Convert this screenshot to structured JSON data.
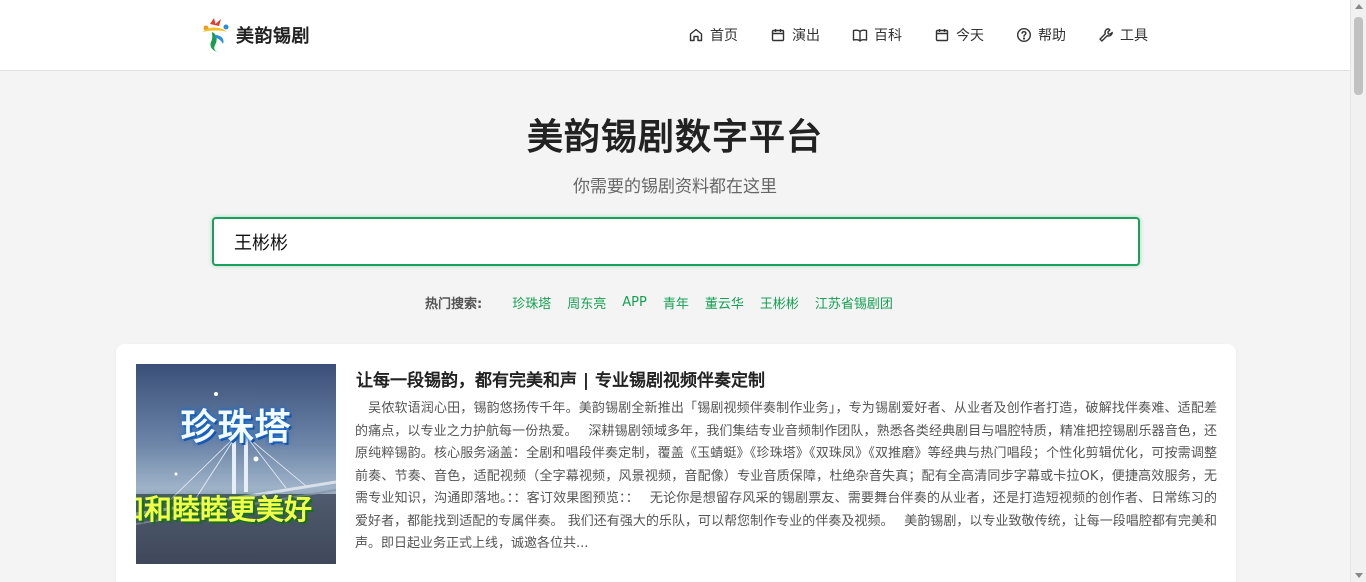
{
  "brand": {
    "name": "美韵锡剧"
  },
  "nav": [
    {
      "label": "首页",
      "icon": "home-icon"
    },
    {
      "label": "演出",
      "icon": "calendar-icon"
    },
    {
      "label": "百科",
      "icon": "book-icon"
    },
    {
      "label": "今天",
      "icon": "calendar-icon"
    },
    {
      "label": "帮助",
      "icon": "help-circle-icon"
    },
    {
      "label": "工具",
      "icon": "wrench-icon"
    }
  ],
  "hero": {
    "title": "美韵锡剧数字平台",
    "subtitle": "你需要的锡剧资料都在这里"
  },
  "search": {
    "value": "王彬彬"
  },
  "hot_search": {
    "label": "热门搜索:",
    "tags": [
      "珍珠塔",
      "周东亮",
      "APP",
      "青年",
      "董云华",
      "王彬彬",
      "江苏省锡剧团"
    ]
  },
  "result": {
    "thumb_title": "珍珠塔",
    "thumb_subtitle": "和和睦睦更美好",
    "title": "让每一段锡韵，都有完美和声 | 专业锡剧视频伴奏定制",
    "description": "　吴侬软语润心田，锡韵悠扬传千年。美韵锡剧全新推出「锡剧视频伴奏制作业务」，专为锡剧爱好者、从业者及创作者打造，破解找伴奏难、适配差的痛点，以专业之力护航每一份热爱。　  深耕锡剧领域多年，我们集结专业音频制作团队，熟悉各类经典剧目与唱腔特质，精准把控锡剧乐器音色，还原纯粹锡韵。核心服务涵盖：全剧和唱段伴奏定制，覆盖《玉蜻蜓》《珍珠塔》《双珠凤》《双推磨》等经典与热门唱段；个性化剪辑优化，可按需调整前奏、节奏、音色，适配视频（全字幕视频，风景视频，音配像）专业音质保障，杜绝杂音失真；配有全高清同步字幕或卡拉OK，便捷高效服务，无需专业知识，沟通即落地。：：客订效果图预览：：　  无论你是想留存风采的锡剧票友、需要舞台伴奏的从业者，还是打造短视频的创作者、日常练习的爱好者，都能找到适配的专属伴奏。 我们还有强大的乐队，可以帮您制作专业的伴奏及视频。　  美韵锡剧，以专业致敬传统，让每一段唱腔都有完美和声。即日起业务正式上线，诚邀各位共..."
  },
  "colors": {
    "accent": "#19a05a",
    "link": "#15a052"
  }
}
